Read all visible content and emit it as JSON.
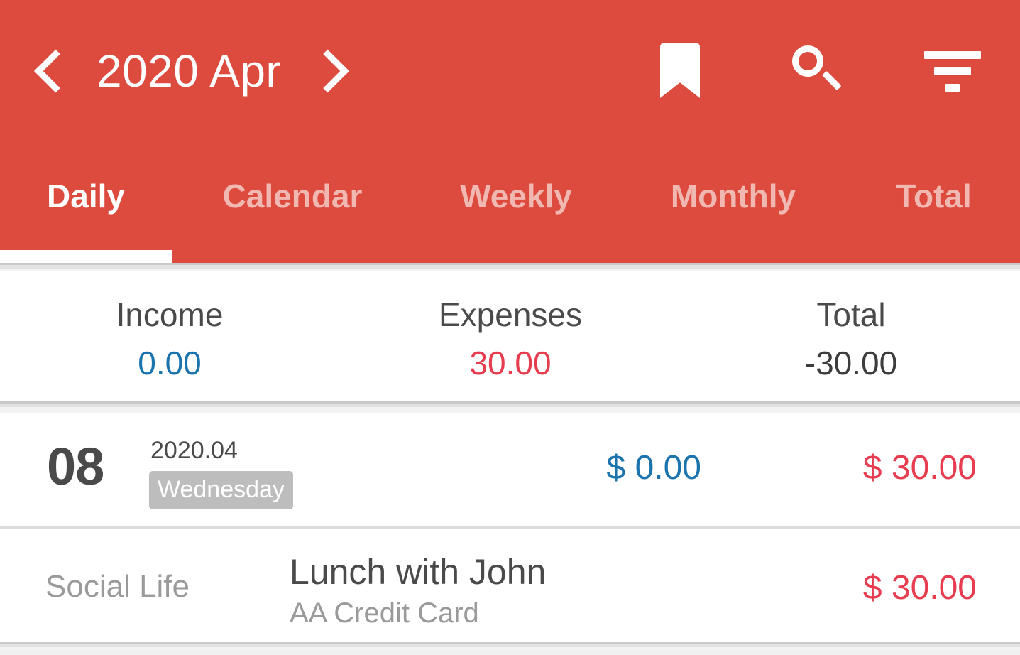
{
  "header": {
    "background_color": "#DD4B3E",
    "month_label": "2020 Apr",
    "prev_icon": "chevron-left-icon",
    "next_icon": "chevron-right-icon",
    "actions": [
      {
        "name": "bookmark-icon",
        "label": "Bookmark"
      },
      {
        "name": "search-icon",
        "label": "Search"
      },
      {
        "name": "filter-icon",
        "label": "Filter"
      }
    ]
  },
  "tabs": {
    "active_index": 0,
    "items": [
      {
        "label": "Daily"
      },
      {
        "label": "Calendar"
      },
      {
        "label": "Weekly"
      },
      {
        "label": "Monthly"
      },
      {
        "label": "Total"
      }
    ]
  },
  "summary": {
    "income": {
      "label": "Income",
      "value": "0.00",
      "color": "#1B74AD"
    },
    "expenses": {
      "label": "Expenses",
      "value": "30.00",
      "color": "#E63E50"
    },
    "total": {
      "label": "Total",
      "value": "-30.00",
      "color": "#3D3D3D"
    }
  },
  "day_group": {
    "day": "08",
    "year_month": "2020.04",
    "weekday": "Wednesday",
    "weekday_badge_color": "#BDBDBD",
    "income_amount": "$ 0.00",
    "expense_amount": "$ 30.00"
  },
  "transactions": [
    {
      "category": "Social Life",
      "title": "Lunch with John",
      "account": "AA Credit Card",
      "amount": "$ 30.00",
      "amount_color": "#E63E50"
    }
  ]
}
